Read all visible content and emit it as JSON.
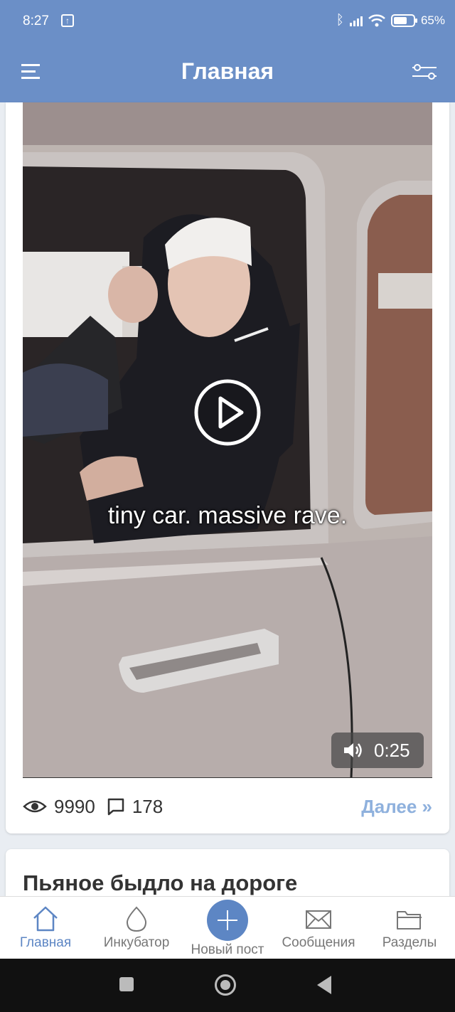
{
  "status_bar": {
    "time": "8:27",
    "battery": "65%"
  },
  "app_bar": {
    "title": "Главная"
  },
  "post": {
    "video_caption": "tiny car. massive rave.",
    "duration": "0:25",
    "views": "9990",
    "comments": "178",
    "more_label": "Далее »"
  },
  "next_post": {
    "title": "Пьяное быдло на дороге"
  },
  "tabs": [
    {
      "label": "Главная",
      "icon": "home-icon",
      "active": true
    },
    {
      "label": "Инкубатор",
      "icon": "egg-icon",
      "active": false
    },
    {
      "label": "Новый пост",
      "icon": "plus-icon",
      "active": false
    },
    {
      "label": "Сообщения",
      "icon": "envelope-icon",
      "active": false
    },
    {
      "label": "Разделы",
      "icon": "folder-icon",
      "active": false
    }
  ],
  "colors": {
    "primary": "#6b8fc7",
    "accent": "#5d86c4",
    "link": "#8fb1dd"
  }
}
